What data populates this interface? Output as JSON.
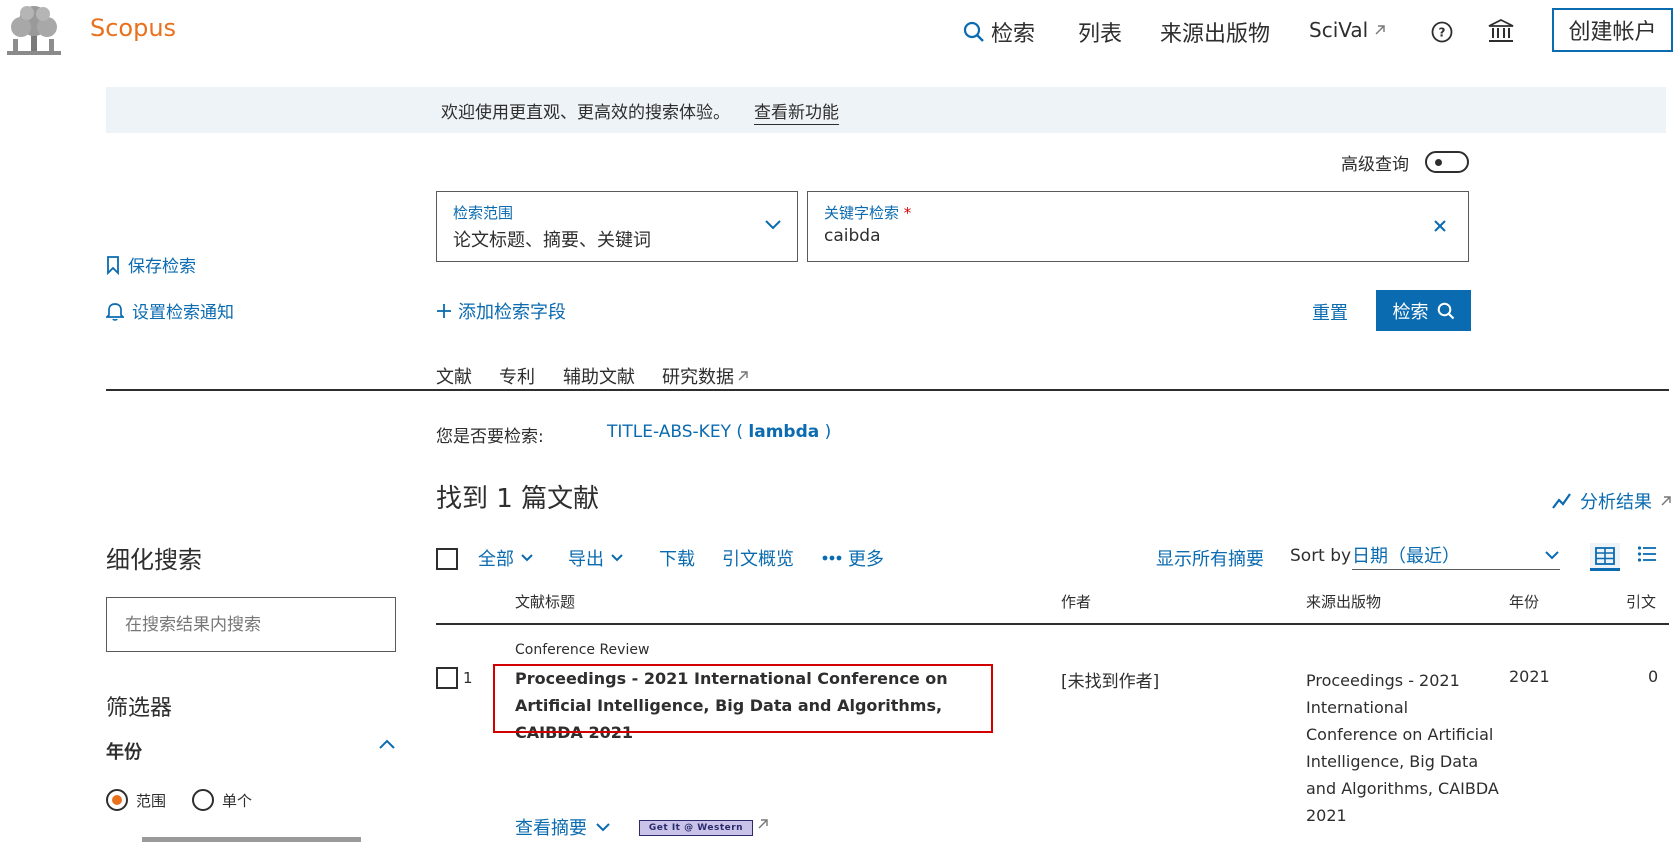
{
  "header": {
    "brand": "Scopus",
    "nav": {
      "search": "检索",
      "lists": "列表",
      "sources": "来源出版物",
      "scival": "SciVal"
    },
    "create_account": "创建帐户"
  },
  "banner": {
    "text": "欢迎使用更直观、更高效的搜索体验。",
    "link": "查看新功能"
  },
  "advanced_query": {
    "label": "高级查询",
    "enabled": false
  },
  "search": {
    "scope_label": "检索范围",
    "scope_value": "论文标题、摘要、关键词",
    "keyword_label": "关键字检索",
    "required_mark": "*",
    "keyword_value": "caibda",
    "add_field": "添加检索字段",
    "reset": "重置",
    "submit": "检索"
  },
  "sidebar_actions": {
    "save_search": "保存检索",
    "set_alert": "设置检索通知"
  },
  "doc_type_tabs": [
    "文献",
    "专利",
    "辅助文献",
    "研究数据"
  ],
  "did_you_mean": {
    "label": "您是否要检索:",
    "query_prefix": "TITLE-ABS-KEY ( ",
    "query_term": "lambda",
    "query_suffix": " )"
  },
  "results": {
    "count_text": "找到 1 篇文献",
    "analyze": "分析结果"
  },
  "refine": {
    "heading": "细化搜索",
    "search_placeholder": "在搜索结果内搜索",
    "filters_heading": "筛选器",
    "year_label": "年份",
    "range_option": "范围",
    "single_option": "单个",
    "selected": "range"
  },
  "toolbar": {
    "all": "全部",
    "export": "导出",
    "download": "下载",
    "citation_overview": "引文概览",
    "more": "更多",
    "show_abstracts": "显示所有摘要",
    "sort_by": "Sort by",
    "sort_value": "日期（最近）"
  },
  "table": {
    "headers": {
      "title": "文献标题",
      "authors": "作者",
      "source": "来源出版物",
      "year": "年份",
      "cites": "引文"
    },
    "rows": [
      {
        "number": "1",
        "doc_type": "Conference Review",
        "title": "Proceedings - 2021 International Conference on Artificial Intelligence, Big Data and Algorithms, CAIBDA 2021",
        "authors": "[未找到作者]",
        "source": "Proceedings - 2021 International Conference on Artificial Intelligence, Big Data and Algorithms, CAIBDA 2021",
        "year": "2021",
        "cites": "0",
        "view_abstract": "查看摘要",
        "get_it": "Get It @ Western"
      }
    ]
  },
  "colors": {
    "brand_orange": "#e9711c",
    "link_blue": "#0b6bb0",
    "highlight_red": "#d30000"
  },
  "icons": [
    "elsevier-logo",
    "search-icon",
    "external-link-icon",
    "help-icon",
    "institution-icon",
    "chevron-down-icon",
    "close-icon",
    "bookmark-icon",
    "bell-icon",
    "plus-icon",
    "analyze-icon",
    "ellipsis-icon",
    "grid-view-icon",
    "list-view-icon",
    "chevron-up-icon"
  ]
}
